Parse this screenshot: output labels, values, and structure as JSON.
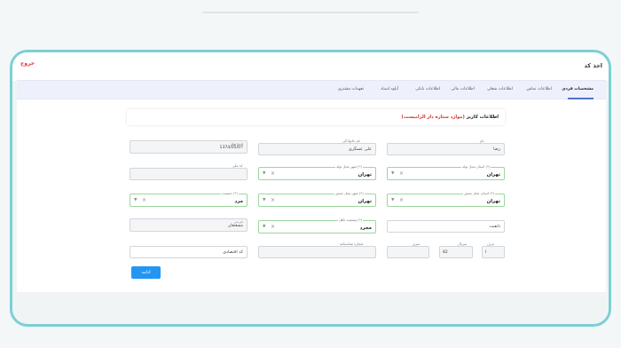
{
  "app": {
    "brand": "اخذ کد",
    "logout_label": "خروج"
  },
  "tabs": [
    {
      "label": "مشخصات فردی",
      "active": true
    },
    {
      "label": "اطلاعات تماس"
    },
    {
      "label": "اطلاعات شغلی"
    },
    {
      "label": "اطلاعات مالی"
    },
    {
      "label": "اطلاعات بانکی"
    },
    {
      "label": "آپلود اسناد"
    },
    {
      "label": "تعهدات مشتری"
    }
  ],
  "card": {
    "title": "اطلاعات کاربر",
    "required_note": "(موارد ستاره دار الزامیست)"
  },
  "fields": {
    "first_name": {
      "label": "نام",
      "value": "رضا"
    },
    "last_name": {
      "label": "نام خانوادگی",
      "value": "علی عسگری"
    },
    "birth_date": {
      "label": "تاریخ تولد",
      "value": "1374/05/07"
    },
    "birth_province": {
      "label": "استان محل تولد (*)",
      "value": "تهران"
    },
    "birth_city": {
      "label": "شهر محل تولد (*)",
      "value": "تهران"
    },
    "national_code": {
      "label": "کد ملی",
      "value": ""
    },
    "issue_province": {
      "label": "استان محل صدور (*)",
      "value": "تهران"
    },
    "issue_city": {
      "label": "شهر محل صدور (*)",
      "value": "تهران"
    },
    "gender": {
      "label": "جنسیت (*)",
      "value": "مرد"
    },
    "nationality": {
      "value": "تابعیت"
    },
    "marital_status": {
      "label": "وضعیت تاهل (*)",
      "value": "مجرد"
    },
    "father_name": {
      "label": "نام پدر",
      "value": "مسعتعان"
    },
    "letter": {
      "label": "حرف",
      "value": "ا"
    },
    "serial": {
      "label": "سریال",
      "value": "82"
    },
    "series": {
      "label": "سری",
      "value": ""
    },
    "id_number": {
      "label": "شماره شناسنامه",
      "value": ""
    },
    "economic_code": {
      "value": "کد اقتصادی"
    }
  },
  "actions": {
    "continue_label": "ادامه"
  },
  "colors": {
    "frame": "#7ccfd6",
    "accent": "#2196f3",
    "tab_indicator": "#4e73c8",
    "required": "#d32f2f",
    "logout": "#e53935",
    "select_border": "#9ad79e"
  },
  "icons": {
    "clear": "times-icon",
    "dropdown": "caret-down-icon"
  }
}
